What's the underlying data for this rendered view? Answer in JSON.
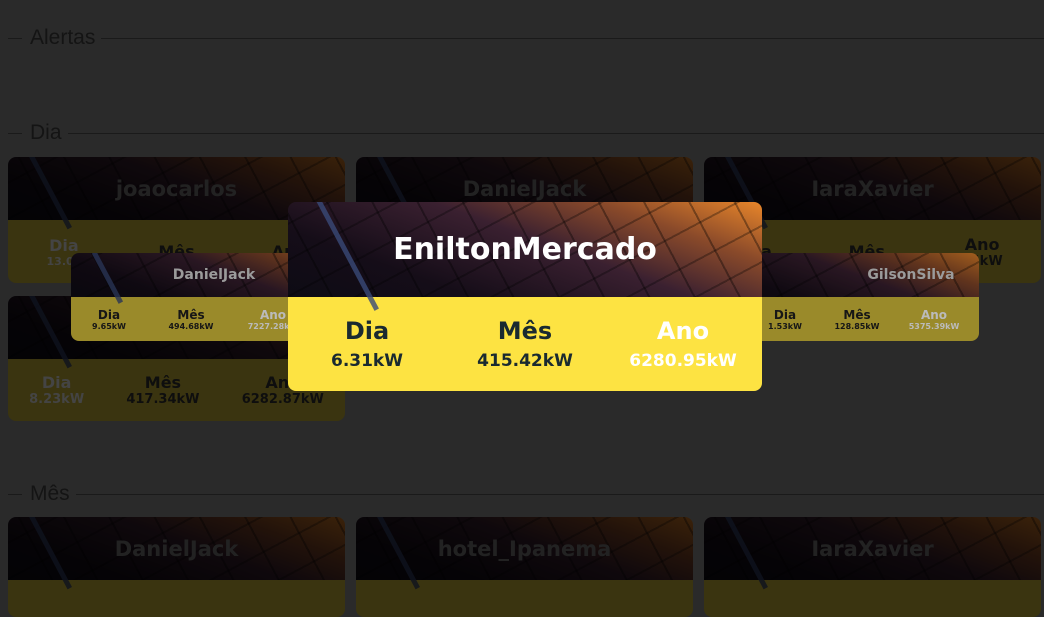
{
  "sections": {
    "alerts": "Alertas",
    "day": "Dia",
    "month": "Mês"
  },
  "labels": {
    "dia": "Dia",
    "mes": "Mês",
    "ano": "Ano"
  },
  "day_cards": [
    {
      "name": "joaocarlos",
      "dia": "13.03",
      "mes": "",
      "ano": ""
    },
    {
      "name": "DanielJack",
      "dia": "",
      "mes": "",
      "ano": ""
    },
    {
      "name": "IaraXavier",
      "dia": "",
      "mes": "",
      "ano": "04kW"
    },
    {
      "name": "",
      "dia": "8.23kW",
      "mes": "417.34kW",
      "ano": "6282.87kW"
    }
  ],
  "month_cards": [
    {
      "name": "DanielJack"
    },
    {
      "name": "hotel_Ipanema"
    },
    {
      "name": "IaraXavier"
    }
  ],
  "hover_left": {
    "name": "DanielJack",
    "dia": "9.65kW",
    "mes": "494.68kW",
    "ano": "7227.28kW"
  },
  "hover_right": {
    "name": "GilsonSilva",
    "dia": "1.53kW",
    "mes": "128.85kW",
    "ano": "5375.39kW"
  },
  "focused": {
    "name": "EniltonMercado",
    "dia": "6.31kW",
    "mes": "415.42kW",
    "ano": "6280.95kW"
  },
  "colors": {
    "yellow": "#fde342",
    "text": "#1a2a30"
  }
}
